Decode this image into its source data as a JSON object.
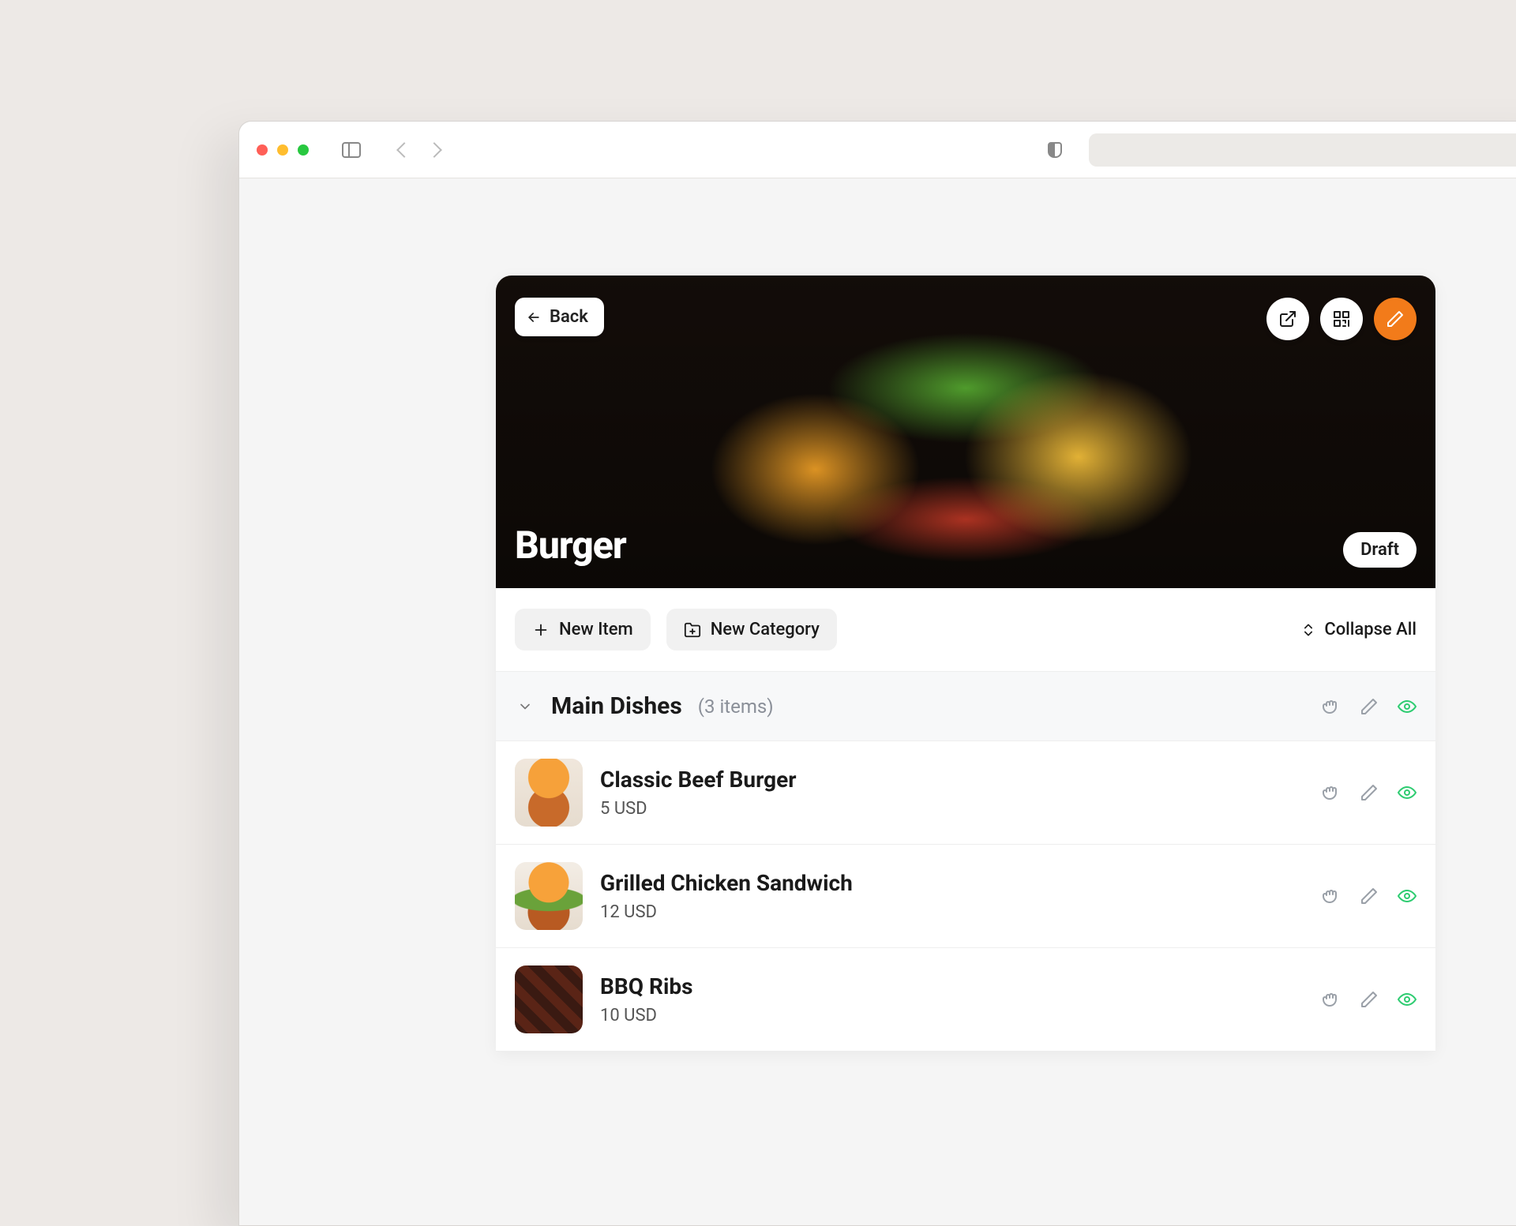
{
  "browser": {
    "address": ""
  },
  "hero": {
    "back_label": "Back",
    "title": "Burger",
    "status": "Draft"
  },
  "toolbar": {
    "new_item": "New Item",
    "new_category": "New Category",
    "collapse_all": "Collapse All"
  },
  "category": {
    "name": "Main Dishes",
    "count_label": "(3 items)"
  },
  "items": [
    {
      "name": "Classic Beef Burger",
      "price": "5 USD"
    },
    {
      "name": "Grilled Chicken Sandwich",
      "price": "12 USD"
    },
    {
      "name": "BBQ Ribs",
      "price": "10 USD"
    }
  ],
  "icons": {
    "external": "external-link-icon",
    "qr": "qr-code-icon",
    "edit": "pencil-icon",
    "plus": "plus-icon",
    "folder_plus": "folder-plus-icon",
    "expand": "chevrons-up-down-icon",
    "chevron_down": "chevron-down-icon",
    "grab": "grab-icon",
    "eye": "eye-icon"
  }
}
